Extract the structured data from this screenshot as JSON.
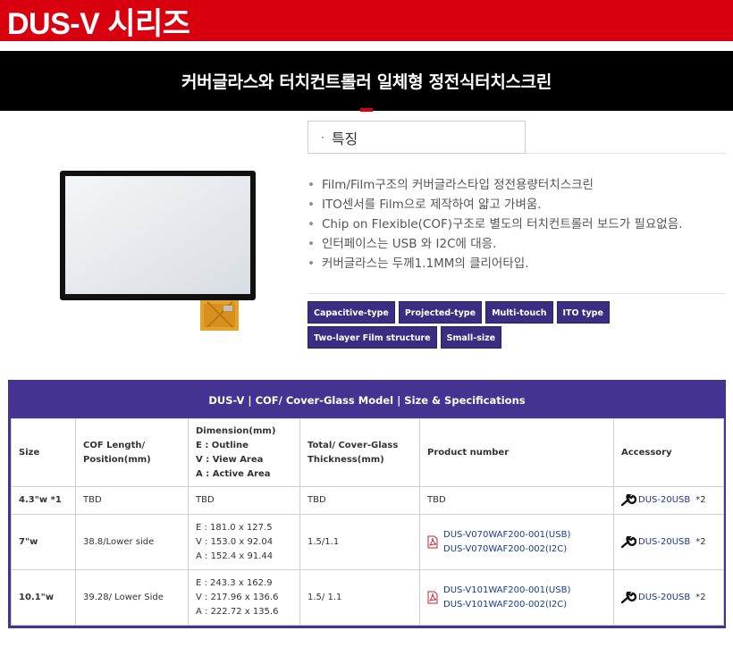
{
  "header": {
    "title": "DUS-V 시리즈"
  },
  "banner": {
    "subtitle": "커버글라스와 터치컨트롤러 일체형 정전식터치스크린"
  },
  "features": {
    "heading_bullet": "·",
    "heading": "특징",
    "bullet_glyph": "•",
    "items": [
      "Film/Film구조의 커버글라스타입 정전용량터치스크린",
      "ITO센서를 Film으로 제작하여 얇고 가벼움.",
      "Chip on Flexible(COF)구조로 별도의 터치컨트롤러 보드가 필요없음.",
      "인터페이스는 USB 와 I2C에 대응.",
      "커버글라스는 두께1.1MM의 클리어타입."
    ],
    "tags": [
      "Capacitive-type",
      "Projected-type",
      "Multi-touch",
      "ITO type",
      "Two-layer Film structure",
      "Small-size"
    ]
  },
  "spec": {
    "title": "DUS-V | COF/ Cover-Glass Model | Size & Specifications",
    "headers": {
      "size": "Size",
      "cof_1": "COF Length/",
      "cof_2": "Position(mm)",
      "dim_1": "Dimension(mm)",
      "dim_2": "E : Outline",
      "dim_3": "V : View Area",
      "dim_4": "A : Active Area",
      "thick_1": "Total/ Cover-Glass",
      "thick_2": "Thickness(mm)",
      "product": "Product number",
      "accessory": "Accessory"
    },
    "rows": [
      {
        "size": "4.3\"w *1",
        "cof": "TBD",
        "dim": [
          "TBD"
        ],
        "thickness": "TBD",
        "products": [
          "TBD"
        ],
        "accessory": "DUS-20USB",
        "accessory_note": "*2"
      },
      {
        "size": "7\"w",
        "cof": "38.8/Lower side",
        "dim": [
          "E : 181.0 x 127.5",
          "V : 153.0 x 92.04",
          "A : 152.4 x 91.44"
        ],
        "thickness": "1.5/1.1",
        "products": [
          "DUS-V070WAF200-001(USB)",
          "DUS-V070WAF200-002(I2C)"
        ],
        "accessory": "DUS-20USB",
        "accessory_note": "*2"
      },
      {
        "size": "10.1\"w",
        "cof": "39.28/ Lower Side",
        "dim": [
          "E : 243.3 x 162.9",
          "V : 217.96 x 136.6",
          "A : 222.72 x 135.6"
        ],
        "thickness": "1.5/ 1.1",
        "products": [
          "DUS-V101WAF200-001(USB)",
          "DUS-V101WAF200-002(I2C)"
        ],
        "accessory": "DUS-20USB",
        "accessory_note": "*2"
      }
    ]
  },
  "colors": {
    "brand_red": "#d8000f",
    "header_purple": "#453391",
    "tag_purple": "#3b2d82",
    "link_blue": "#1a3a8a"
  }
}
